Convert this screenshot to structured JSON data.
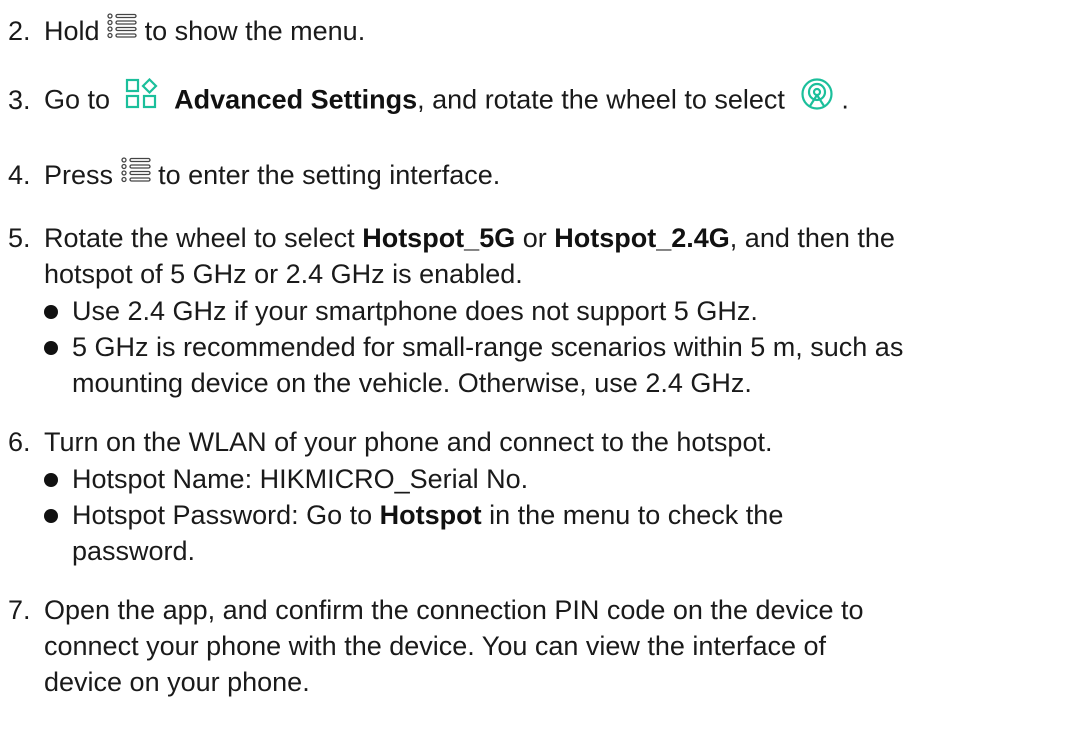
{
  "steps": {
    "s2": {
      "num": "2.",
      "pre": "Hold",
      "post": "to show the menu.",
      "icon": "menu-icon"
    },
    "s3": {
      "num": "3.",
      "pre": "Go to",
      "bold": "Advanced Settings",
      "mid": ", and rotate the wheel to select",
      "post": ".",
      "icon1": "advanced-settings-icon",
      "icon2": "hotspot-icon"
    },
    "s4": {
      "num": "4.",
      "pre": "Press",
      "post": "to enter the setting interface.",
      "icon": "menu-icon"
    },
    "s5": {
      "num": "5.",
      "pre": "Rotate the wheel to select",
      "bold1": "Hotspot_5G",
      "mid": "or",
      "bold2": "Hotspot_2.4G",
      "post": ", and then the",
      "line2": "hotspot of 5 GHz or 2.4 GHz is enabled.",
      "bullets": [
        "Use 2.4 GHz if your smartphone does not support 5 GHz.",
        "5 GHz is recommended for small-range scenarios within 5 m, such as",
        "mounting device on the vehicle. Otherwise, use 2.4 GHz."
      ]
    },
    "s6": {
      "num": "6.",
      "text": "Turn on the WLAN of your phone and connect to the hotspot.",
      "bullet1": "Hotspot Name: HIKMICRO_Serial No.",
      "bullet2_pre": "Hotspot Password: Go to",
      "bullet2_bold": "Hotspot",
      "bullet2_post": "in the menu to check the",
      "bullet2_line2": "password."
    },
    "s7": {
      "num": "7.",
      "line1": "Open the app, and confirm the connection PIN code on the device to",
      "line2": "connect your phone with the device. You can view the interface of",
      "line3": "device on your phone."
    }
  },
  "colors": {
    "accent": "#1bbf9b",
    "text": "#1a1a1a"
  }
}
